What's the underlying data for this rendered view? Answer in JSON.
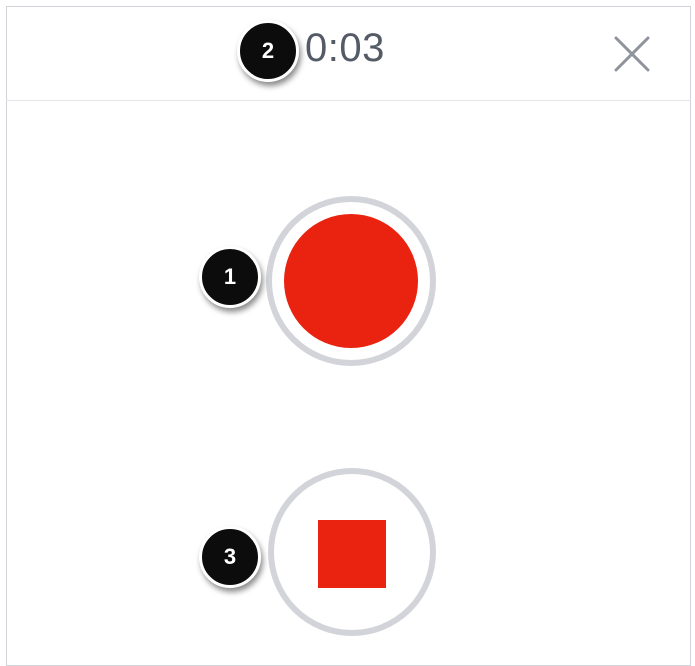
{
  "recorder": {
    "timer": "0:03",
    "close_icon": "close-icon",
    "record_icon": "record-icon",
    "stop_icon": "stop-icon"
  },
  "callouts": {
    "record": "1",
    "timer": "2",
    "stop": "3"
  },
  "colors": {
    "accent": "#ea2310",
    "ring": "#d2d4d9",
    "text": "#545b66",
    "callout": "#0c0c0c"
  }
}
